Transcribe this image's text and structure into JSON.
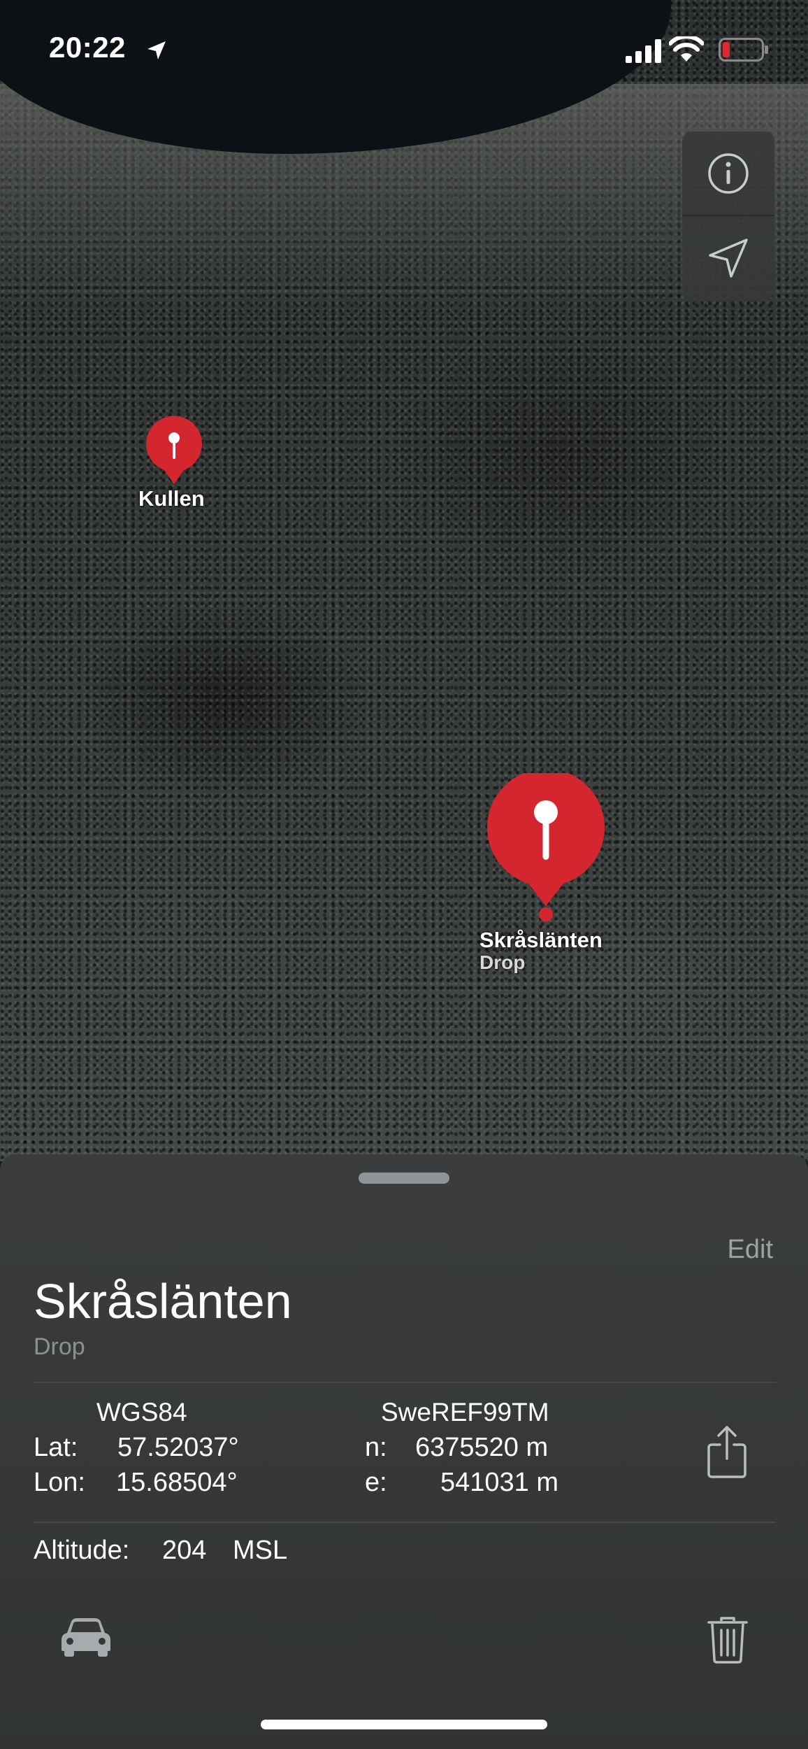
{
  "status_bar": {
    "time": "20:22",
    "icons": [
      "location-arrow-icon",
      "cellular-signal-icon",
      "wifi-icon",
      "battery-low-icon"
    ],
    "battery_color": "#e0282e"
  },
  "map": {
    "type": "satellite",
    "controls": [
      "info-icon",
      "location-arrow-icon"
    ],
    "pins": [
      {
        "label": "Kullen",
        "sublabel": "",
        "selected": false
      },
      {
        "label": "Skråslänten",
        "sublabel": "Drop",
        "selected": true
      }
    ],
    "pin_color": "#d4262f"
  },
  "detail": {
    "edit_label": "Edit",
    "title": "Skråslänten",
    "subtitle": "Drop",
    "wgs84": {
      "header": "WGS84",
      "lat_label": "Lat:",
      "lat_value": "57.52037°",
      "lon_label": "Lon:",
      "lon_value": "15.68504°"
    },
    "sweref": {
      "header": "SweREF99TM",
      "n_label": "n:",
      "n_value": "6375520 m",
      "e_label": "e:",
      "e_value": "541031 m"
    },
    "altitude": {
      "label": "Altitude:",
      "value": "204",
      "unit": "MSL"
    },
    "actions": [
      "share-icon",
      "car-icon",
      "trash-icon"
    ]
  }
}
